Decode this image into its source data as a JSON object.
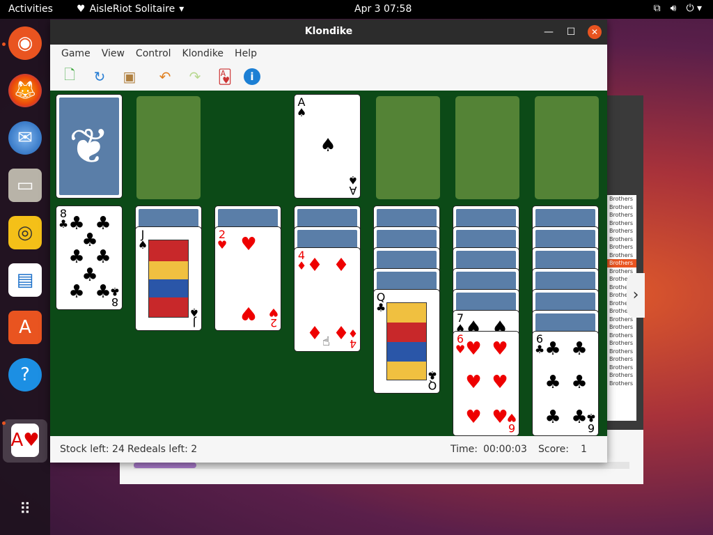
{
  "topbar": {
    "activities": "Activities",
    "app_name": "AisleRiot Solitaire",
    "clock": "Apr 3  07:58"
  },
  "dock": {
    "items": [
      "ubuntu-icon",
      "firefox-icon",
      "thunderbird-icon",
      "files-icon",
      "rhythmbox-icon",
      "libreoffice-writer-icon",
      "software-center-icon",
      "help-icon",
      "aisleriot-icon",
      "show-apps-icon"
    ]
  },
  "window": {
    "title": "Klondike",
    "menu": [
      "Game",
      "View",
      "Control",
      "Klondike",
      "Help"
    ],
    "toolbar": [
      "new-game-icon",
      "restart-icon",
      "deal-icon",
      "undo-icon",
      "redo-icon",
      "hint-icon",
      "info-icon"
    ]
  },
  "background_window": {
    "list_items": [
      "Brothers",
      "Brothers",
      "Brothers",
      "Brothers",
      "Brothers",
      "Brothers",
      "Brothers",
      "Brothers",
      "Brothers",
      "Brothers",
      "Brothers",
      "Brothers",
      "Brothers",
      "Brothers",
      "Brothers",
      "Brothers",
      "Brothers",
      "Brothers",
      "Brothers",
      "Brothers",
      "Brothers",
      "Brothers",
      "Brothers",
      "Brothers"
    ]
  },
  "game": {
    "foundation_ace": {
      "rank": "A",
      "suit": "♠"
    },
    "waste": {
      "rank": "8",
      "suit": "♣"
    },
    "tableau": [
      {
        "rank": "J",
        "suit": "♠"
      },
      {
        "rank": "2",
        "suit": "♥"
      },
      {
        "rank": "4",
        "suit": "♦"
      },
      {
        "rank": "Q",
        "suit": "♣"
      },
      {
        "rank": "7",
        "suit": "♠"
      },
      {
        "rank": "6",
        "suit": "♥"
      },
      {
        "rank": "6",
        "suit": "♣"
      }
    ]
  },
  "status": {
    "stock": "Stock left: 24",
    "redeals": "Redeals left: 2",
    "time_label": "Time:",
    "time_value": "00:00:03",
    "score_label": "Score:",
    "score_value": "1"
  },
  "colors": {
    "felt": "#0c4a17",
    "card_back": "#5a7ea8",
    "accent": "#e95420"
  }
}
